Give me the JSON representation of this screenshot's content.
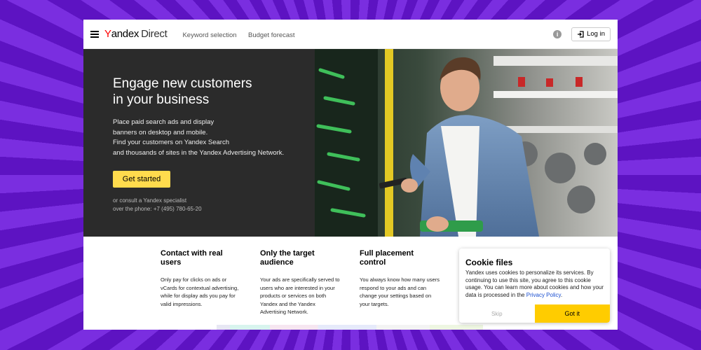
{
  "header": {
    "logo": {
      "y": "Y",
      "rest": "andex",
      "product": "Direct"
    },
    "nav": [
      "Keyword selection",
      "Budget forecast"
    ],
    "info_icon": "i",
    "login_label": "Log in"
  },
  "hero": {
    "title_line1": "Engage new customers",
    "title_line2": "in your business",
    "desc": [
      "Place paid search ads and display",
      "banners on desktop and mobile.",
      "Find your customers on Yandex Search",
      "and thousands of sites in the Yandex Advertising Network."
    ],
    "cta_label": "Get started",
    "consult": [
      "or consult a Yandex specialist",
      "over the phone: +7 (495) 780-65-20"
    ]
  },
  "features": [
    {
      "title": "Contact with real users",
      "text": "Only pay for clicks on ads or vCards for contextual advertising, while for display ads you pay for valid impressions."
    },
    {
      "title": "Only the target audience",
      "text": "Your ads are specifically served to users who are interested in your products or services on both Yandex and the Yandex Advertising Network."
    },
    {
      "title": "Full placement control",
      "text": "You always know how many users respond to your ads and can change your settings based on your targets."
    }
  ],
  "cookie": {
    "title": "Cookie files",
    "text": "Yandex uses cookies to personalize its services. By continuing to use this site, you agree to this cookie usage. You can learn more about cookies and how your data is processed in the",
    "link": "Privacy Policy",
    "after": ".",
    "skip_label": "Skip",
    "got_label": "Got it"
  },
  "colors": {
    "brand_red": "#ff0000",
    "cta_yellow": "#ffdb4d",
    "got_it_yellow": "#ffcc00",
    "hero_dark": "#2b2b2b",
    "backdrop_purple": "#6a1ccf"
  },
  "icons": [
    "menu-icon",
    "info-icon",
    "login-icon"
  ]
}
